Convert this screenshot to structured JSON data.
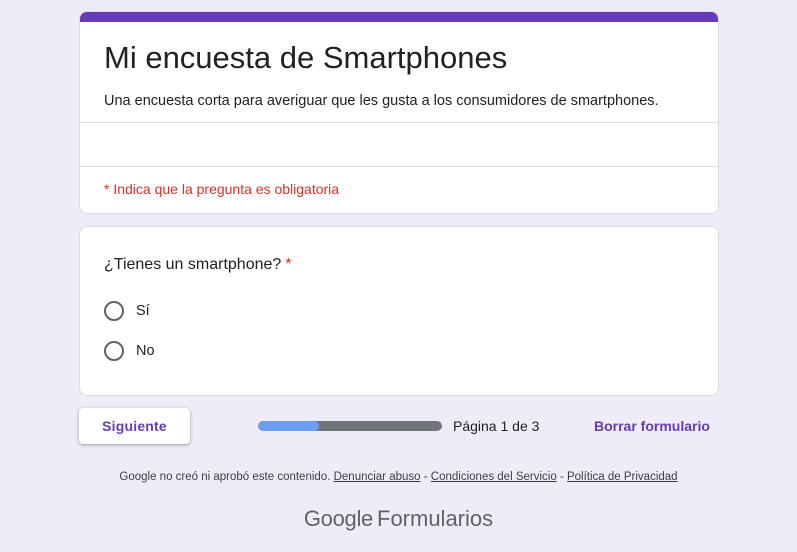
{
  "form": {
    "title": "Mi encuesta de Smartphones",
    "description": "Una encuesta corta para averiguar que les gusta a los consumidores de smartphones.",
    "required_note": "* Indica que la pregunta es obligatoria"
  },
  "question": {
    "title": "¿Tienes un smartphone?",
    "required_marker": "*",
    "options": [
      {
        "label": "Sí",
        "selected": false
      },
      {
        "label": "No",
        "selected": false
      }
    ]
  },
  "navigation": {
    "next_label": "Siguiente",
    "progress_fraction": 0.33,
    "page_indicator": "Página 1 de 3",
    "clear_label": "Borrar formulario"
  },
  "footer": {
    "disclaimer": "Google no creó ni aprobó este contenido.",
    "sep": "-",
    "report_abuse": "Denunciar abuso",
    "terms": "Condiciones del Servicio",
    "privacy": "Política de Privacidad",
    "brand_google": "Google",
    "brand_product": "Formularios"
  },
  "colors": {
    "theme": "#673ab7",
    "background": "#f0ebf8",
    "required": "#d93025",
    "progress_fill": "#6c9ef7",
    "progress_track": "#70757a"
  }
}
